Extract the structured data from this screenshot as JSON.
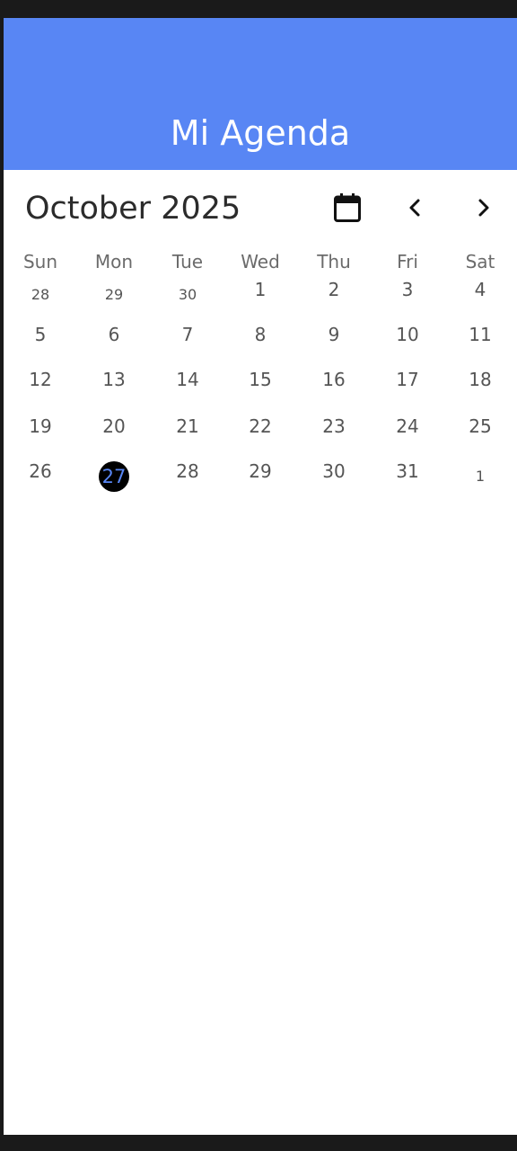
{
  "app_bar": {
    "title": "Mi Agenda",
    "color": "#5886f4"
  },
  "calendar": {
    "month_label": "October 2025",
    "icons": {
      "calendar": "calendar-icon",
      "prev": "chevron-left-icon",
      "next": "chevron-right-icon"
    },
    "weekdays": [
      "Sun",
      "Mon",
      "Tue",
      "Wed",
      "Thu",
      "Fri",
      "Sat"
    ],
    "weeks": [
      [
        "28",
        "29",
        "30",
        "1",
        "2",
        "3",
        "4"
      ],
      [
        "5",
        "6",
        "7",
        "8",
        "9",
        "10",
        "11"
      ],
      [
        "12",
        "13",
        "14",
        "15",
        "16",
        "17",
        "18"
      ],
      [
        "19",
        "20",
        "21",
        "22",
        "23",
        "24",
        "25"
      ],
      [
        "26",
        "27",
        "28",
        "29",
        "30",
        "31",
        "1"
      ]
    ],
    "selected_day": "27",
    "selected_color": "#000000"
  }
}
